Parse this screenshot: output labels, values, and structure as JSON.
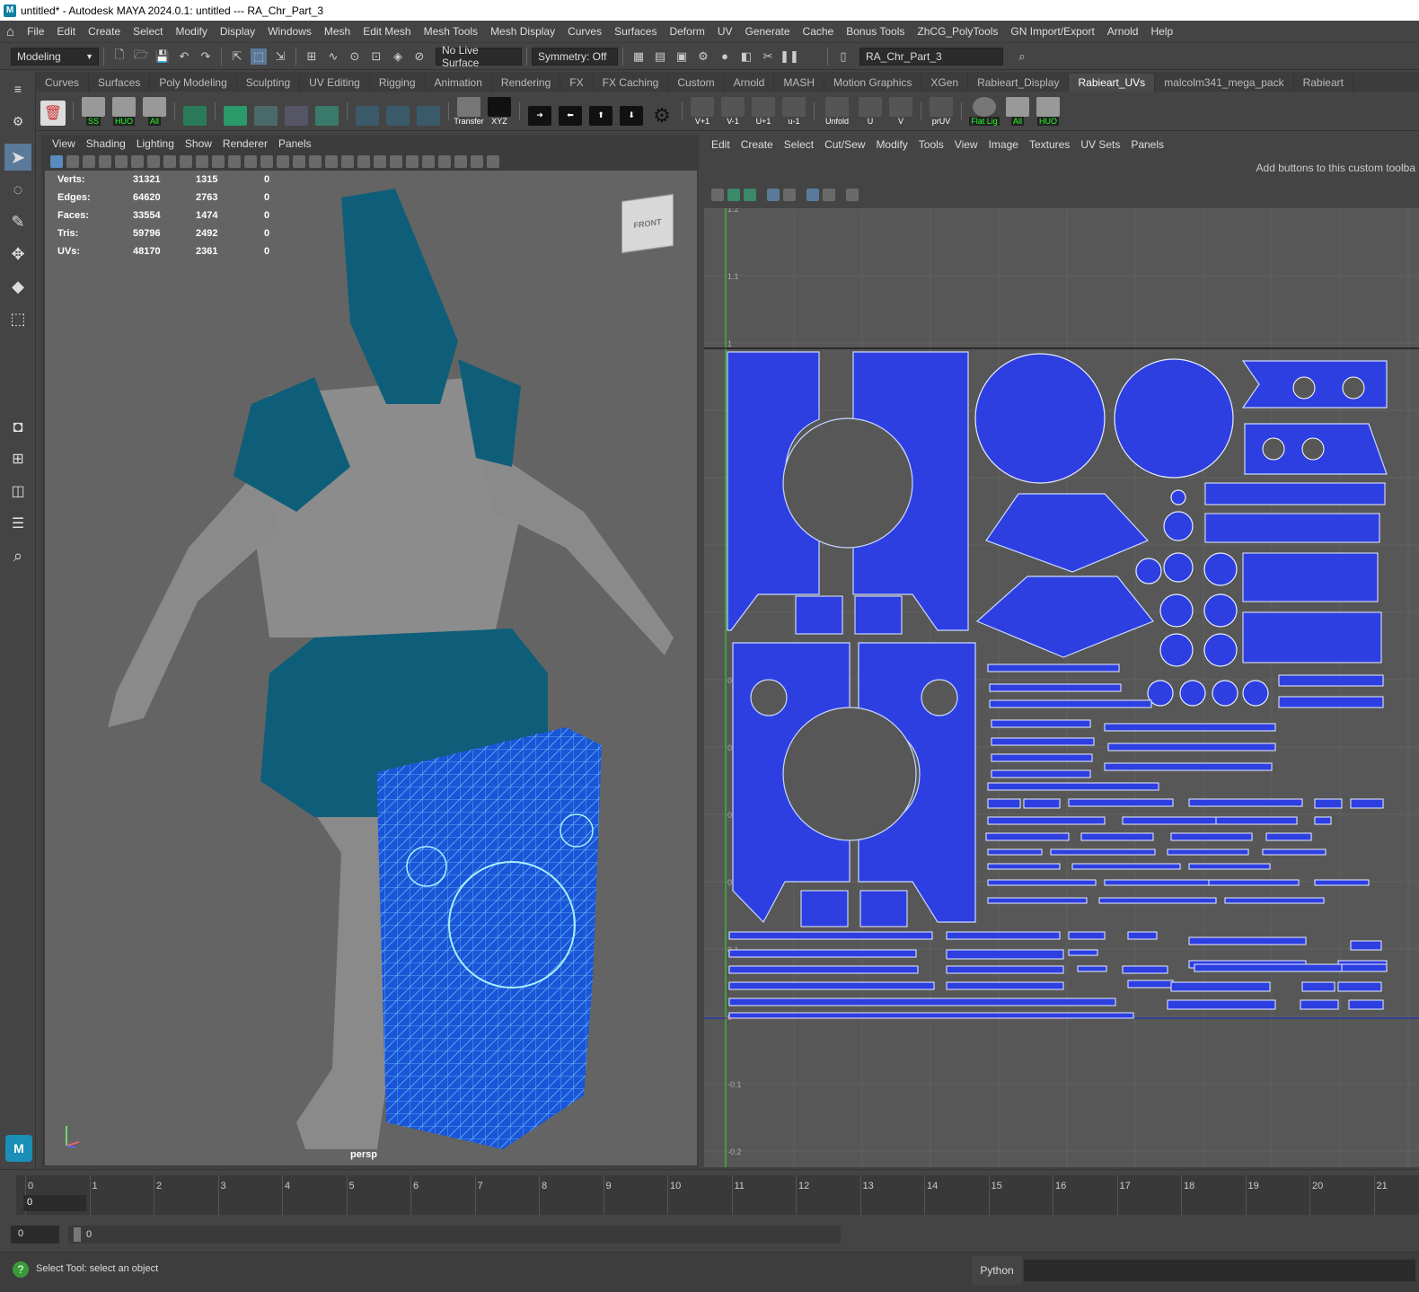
{
  "window": {
    "title": "untitled* - Autodesk MAYA 2024.0.1: untitled  ---  RA_Chr_Part_3"
  },
  "menubar": [
    "File",
    "Edit",
    "Create",
    "Select",
    "Modify",
    "Display",
    "Windows",
    "Mesh",
    "Edit Mesh",
    "Mesh Tools",
    "Mesh Display",
    "Curves",
    "Surfaces",
    "Deform",
    "UV",
    "Generate",
    "Cache",
    "Bonus Tools",
    "ZhCG_PolyTools",
    "GN Import/Export",
    "Arnold",
    "Help"
  ],
  "statusline": {
    "mode": "Modeling",
    "live_surface": "No Live Surface",
    "symmetry": "Symmetry: Off",
    "object_name": "RA_Chr_Part_3"
  },
  "shelf_tabs": [
    "Curves",
    "Surfaces",
    "Poly Modeling",
    "Sculpting",
    "UV Editing",
    "Rigging",
    "Animation",
    "Rendering",
    "FX",
    "FX Caching",
    "Custom",
    "Arnold",
    "MASH",
    "Motion Graphics",
    "XGen",
    "Rabieart_Display",
    "Rabieart_UVs",
    "malcolm341_mega_pack",
    "Rabieart"
  ],
  "active_shelf": "Rabieart_UVs",
  "shelf_buttons": [
    "SS",
    "HUO",
    "All",
    "",
    "",
    "",
    "",
    "",
    "",
    "Transfer",
    "XYZ",
    "",
    "",
    "",
    "",
    "",
    "V+1",
    "V-1",
    "U+1",
    "u-1",
    "Unfold",
    "U",
    "V",
    "prUV",
    "Flat Lig",
    "All",
    "HUO"
  ],
  "viewport": {
    "menu": [
      "View",
      "Shading",
      "Lighting",
      "Show",
      "Renderer",
      "Panels"
    ],
    "hud": [
      {
        "label": "Verts:",
        "total": "31321",
        "sel": "1315",
        "comp": "0"
      },
      {
        "label": "Edges:",
        "total": "64620",
        "sel": "2763",
        "comp": "0"
      },
      {
        "label": "Faces:",
        "total": "33554",
        "sel": "1474",
        "comp": "0"
      },
      {
        "label": "Tris:",
        "total": "59796",
        "sel": "2492",
        "comp": "0"
      },
      {
        "label": "UVs:",
        "total": "48170",
        "sel": "2361",
        "comp": "0"
      }
    ],
    "camera_label": "persp",
    "viewcube_face": "FRONT"
  },
  "uv_editor": {
    "menu": [
      "Edit",
      "Create",
      "Select",
      "Cut/Sew",
      "Modify",
      "Tools",
      "View",
      "Image",
      "Textures",
      "UV Sets",
      "Panels"
    ],
    "custom_toolbar_hint": "Add buttons to this custom toolba",
    "axis_labels": [
      "1.2",
      "1.1",
      "1",
      "0.9",
      "0.8",
      "0.7",
      "0.6",
      "0.5",
      "0.4",
      "0.3",
      "0.2",
      "0.1",
      "0",
      "-0.1",
      "-0.2"
    ],
    "uv_color": "#2d3fe0"
  },
  "timeline": {
    "frames": [
      "0",
      "1",
      "2",
      "3",
      "4",
      "5",
      "6",
      "7",
      "8",
      "9",
      "10",
      "11",
      "12",
      "13",
      "14",
      "15",
      "16",
      "17",
      "18",
      "19",
      "20",
      "21"
    ],
    "current": "0"
  },
  "range": {
    "start": "0",
    "current": "0"
  },
  "helpline": {
    "text": "Select Tool: select an object",
    "cmd_label": "Python"
  }
}
